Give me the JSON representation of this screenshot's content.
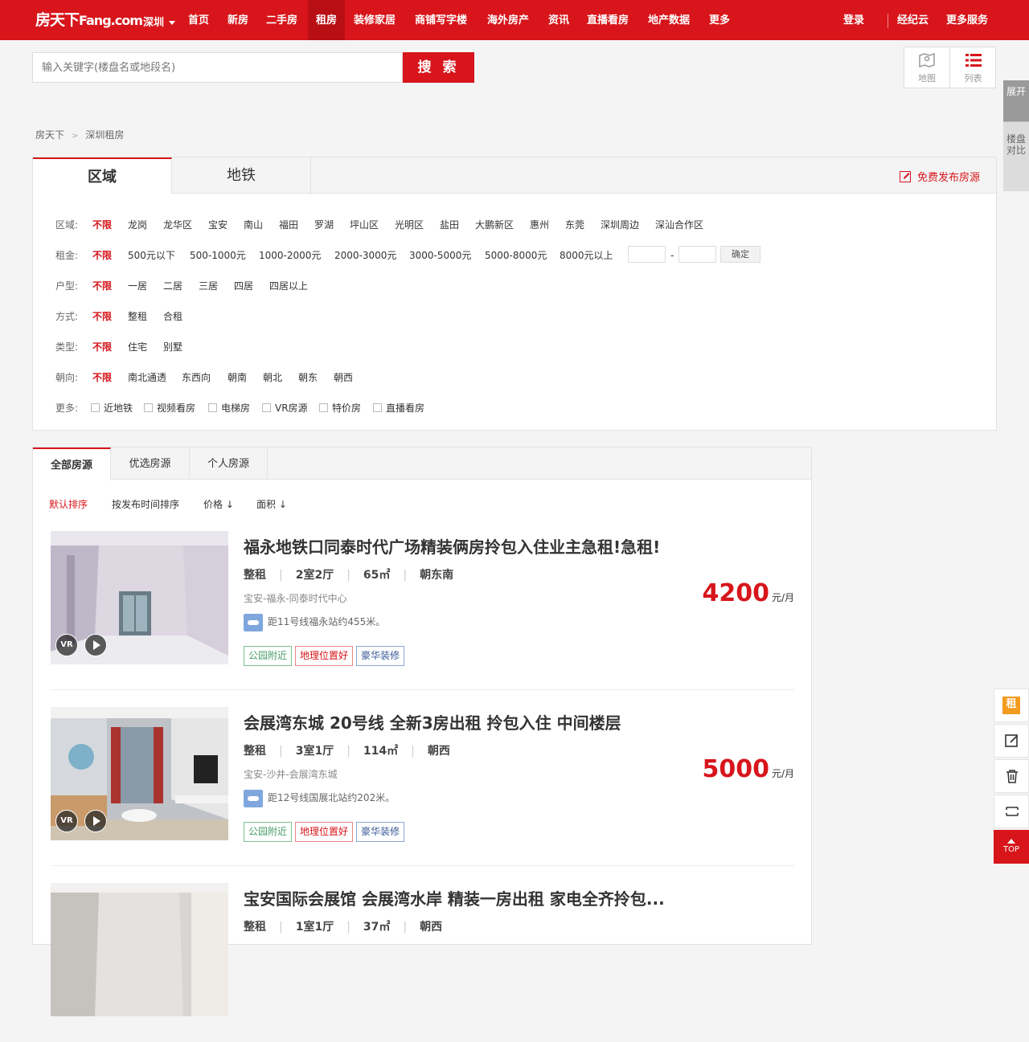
{
  "nav": {
    "logo_cn": "房天下",
    "logo_en": "Fang.com",
    "city": "深圳",
    "items": [
      "首页",
      "新房",
      "二手房",
      "租房",
      "装修家居",
      "商铺写字楼",
      "海外房产",
      "资讯",
      "直播看房",
      "地产数据",
      "更多"
    ],
    "active_index": 3,
    "login": "登录",
    "jingjiyun": "经纪云",
    "more_services": "更多服务"
  },
  "search": {
    "placeholder": "输入关键字(楼盘名或地段名)",
    "button": "搜 索"
  },
  "view_toggle": {
    "map": "地图",
    "list": "列表",
    "map_icon": "map-icon",
    "list_icon": "list-icon"
  },
  "side_tab": {
    "expand": "展开",
    "compare": "楼盘对比"
  },
  "breadcrumb": {
    "home": "房天下",
    "sep": ">",
    "current": "深圳租房"
  },
  "filter": {
    "tabs": [
      "区域",
      "地铁"
    ],
    "active_tab": 0,
    "publish": "免费发布房源",
    "rows": [
      {
        "label": "区域:",
        "options": [
          "不限",
          "龙岗",
          "龙华区",
          "宝安",
          "南山",
          "福田",
          "罗湖",
          "坪山区",
          "光明区",
          "盐田",
          "大鹏新区",
          "惠州",
          "东莞",
          "深圳周边",
          "深汕合作区"
        ]
      },
      {
        "label": "租金:",
        "options": [
          "不限",
          "500元以下",
          "500-1000元",
          "1000-2000元",
          "2000-3000元",
          "3000-5000元",
          "5000-8000元",
          "8000元以上"
        ],
        "range_dash": "-",
        "confirm": "确定"
      },
      {
        "label": "户型:",
        "options": [
          "不限",
          "一居",
          "二居",
          "三居",
          "四居",
          "四居以上"
        ]
      },
      {
        "label": "方式:",
        "options": [
          "不限",
          "整租",
          "合租"
        ]
      },
      {
        "label": "类型:",
        "options": [
          "不限",
          "住宅",
          "别墅"
        ]
      },
      {
        "label": "朝向:",
        "options": [
          "不限",
          "南北通透",
          "东西向",
          "朝南",
          "朝北",
          "朝东",
          "朝西"
        ]
      }
    ],
    "more": {
      "label": "更多:",
      "checks": [
        "近地铁",
        "视频看房",
        "电梯房",
        "VR房源",
        "特价房",
        "直播看房"
      ]
    }
  },
  "list_tabs": [
    "全部房源",
    "优选房源",
    "个人房源"
  ],
  "sorts": [
    "默认排序",
    "按发布时间排序",
    "价格",
    "面积"
  ],
  "listings": [
    {
      "title": "福永地铁口同泰时代广场精装俩房拎包入住业主急租!急租!",
      "type": "整租",
      "layout": "2室2厅",
      "area": "65㎡",
      "orientation": "朝东南",
      "address": "宝安-福永-同泰时代中心",
      "subway_prefix": "距11号线",
      "station": "福永站",
      "subway_suffix": "约455米。",
      "tags": [
        "公园附近",
        "地理位置好",
        "豪华装修"
      ],
      "price": "4200",
      "unit": "元/月",
      "vr": "VR"
    },
    {
      "title": "会展湾东城 20号线 全新3房出租 拎包入住 中间楼层",
      "type": "整租",
      "layout": "3室1厅",
      "area": "114㎡",
      "orientation": "朝西",
      "address": "宝安-沙井-会展湾东城",
      "subway_prefix": "距12号线",
      "station": "国展北站",
      "subway_suffix": "约202米。",
      "tags": [
        "公园附近",
        "地理位置好",
        "豪华装修"
      ],
      "price": "5000",
      "unit": "元/月",
      "vr": "VR"
    },
    {
      "title": "宝安国际会展馆 会展湾水岸 精装一房出租 家电全齐拎包...",
      "type": "整租",
      "layout": "1室1厅",
      "area": "37㎡",
      "orientation": "朝西",
      "address": "",
      "subway_prefix": "",
      "station": "",
      "subway_suffix": "",
      "tags": [],
      "price": "",
      "unit": "",
      "vr": ""
    }
  ],
  "tools": {
    "rent": "租",
    "top": "TOP"
  }
}
